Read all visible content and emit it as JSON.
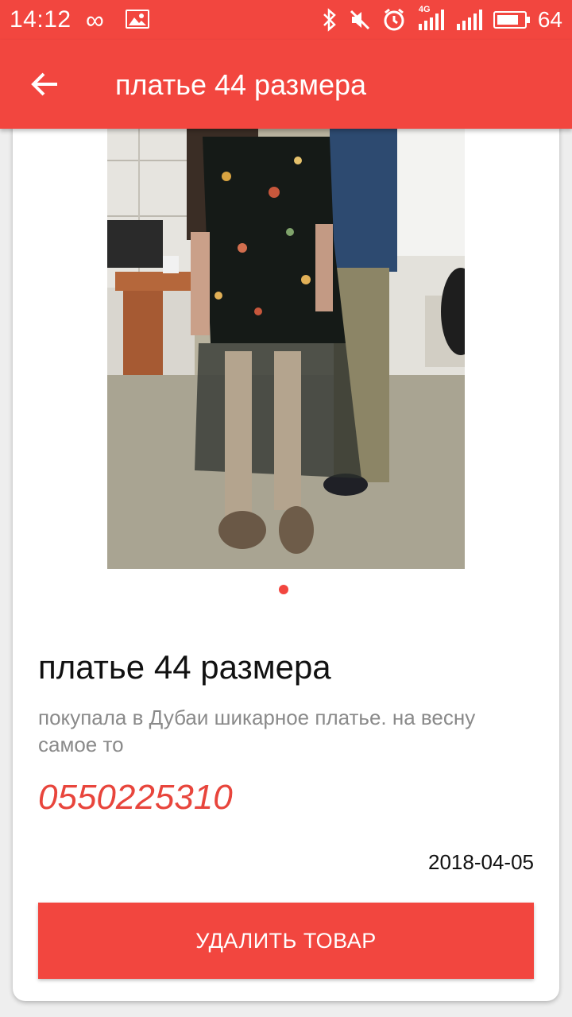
{
  "status_bar": {
    "time": "14:12",
    "infinity_glyph": "∞",
    "network_label": "4G",
    "battery_percent": "64"
  },
  "app_bar": {
    "title": "платье 44 размера",
    "back_icon": "arrow-left-icon"
  },
  "product": {
    "title": "платье 44 размера",
    "description": "покупала в Дубаи шикарное платье. на весну самое то",
    "phone": "0550225310",
    "date": "2018-04-05",
    "photo_count": 1,
    "photo_index": 1
  },
  "actions": {
    "delete_label": "УДАЛИТЬ ТОВАР"
  },
  "colors": {
    "primary": "#f2463f",
    "phone": "#e8453c",
    "description": "#8a8a8a"
  }
}
